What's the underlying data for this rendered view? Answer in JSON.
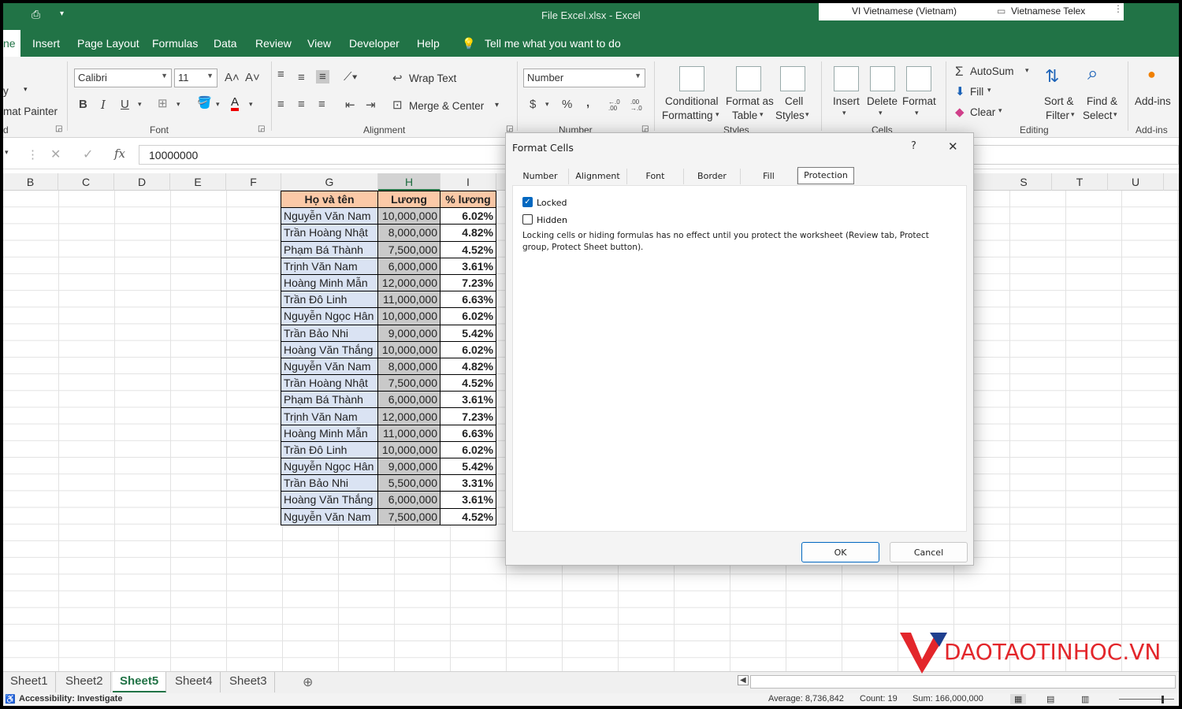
{
  "window": {
    "title": "File Excel.xlsx  -  Excel"
  },
  "language_bar": {
    "ime": "VI  Vietnamese (Vietnam)",
    "keyboard": "Vietnamese Telex"
  },
  "menu": {
    "items": [
      "ne",
      "Insert",
      "Page Layout",
      "Formulas",
      "Data",
      "Review",
      "View",
      "Developer",
      "Help"
    ],
    "tell_me": "Tell me what you want to do"
  },
  "ribbon": {
    "clipboard": {
      "copy": "y",
      "format_painter": "mat Painter",
      "group": "d"
    },
    "font": {
      "name": "Calibri",
      "size": "11",
      "group": "Font",
      "bold": "B",
      "italic": "I",
      "underline": "U",
      "font_color": "A"
    },
    "alignment": {
      "wrap_text": "Wrap Text",
      "merge_center": "Merge & Center",
      "group": "Alignment"
    },
    "number": {
      "format": "Number",
      "group": "Number",
      "currency": "$",
      "percent": "%",
      "comma": ",",
      "inc_decimal": "←.0 .00",
      "dec_decimal": ".00 →.0"
    },
    "styles": {
      "conditional_1": "Conditional",
      "conditional_2": "Formatting",
      "format_table_1": "Format as",
      "format_table_2": "Table",
      "cell_styles_1": "Cell",
      "cell_styles_2": "Styles",
      "group": "Styles"
    },
    "cells": {
      "insert": "Insert",
      "delete": "Delete",
      "format": "Format",
      "group": "Cells"
    },
    "editing": {
      "autosum": "AutoSum",
      "fill": "Fill",
      "clear": "Clear",
      "sort_1": "Sort &",
      "sort_2": "Filter",
      "find_1": "Find &",
      "find_2": "Select",
      "group": "Editing"
    },
    "addins": {
      "label": "Add-ins",
      "group": "Add-ins"
    }
  },
  "formula_bar": {
    "value": "10000000",
    "fx": "fx"
  },
  "columns": [
    {
      "label": "B",
      "w": 70
    },
    {
      "label": "C",
      "w": 71
    },
    {
      "label": "D",
      "w": 71
    },
    {
      "label": "E",
      "w": 71
    },
    {
      "label": "F",
      "w": 70
    },
    {
      "label": "G",
      "w": 123
    },
    {
      "label": "H",
      "w": 79
    },
    {
      "label": "I",
      "w": 71
    }
  ],
  "right_columns": [
    "S",
    "T",
    "U"
  ],
  "table": {
    "headers": [
      "Họ và tên",
      "Lương",
      "% lương"
    ],
    "rows": [
      [
        "Nguyễn Văn Nam",
        "10,000,000",
        "6.02%"
      ],
      [
        "Trần Hoàng Nhật",
        "8,000,000",
        "4.82%"
      ],
      [
        "Phạm Bá Thành",
        "7,500,000",
        "4.52%"
      ],
      [
        "Trịnh Văn Nam",
        "6,000,000",
        "3.61%"
      ],
      [
        "Hoàng Minh Mẫn",
        "12,000,000",
        "7.23%"
      ],
      [
        "Trần Đô Linh",
        "11,000,000",
        "6.63%"
      ],
      [
        "Nguyễn Ngọc Hân",
        "10,000,000",
        "6.02%"
      ],
      [
        "Trần Bảo Nhi",
        "9,000,000",
        "5.42%"
      ],
      [
        "Hoàng Văn Thắng",
        "10,000,000",
        "6.02%"
      ],
      [
        "Nguyễn Văn Nam",
        "8,000,000",
        "4.82%"
      ],
      [
        "Trần Hoàng Nhật",
        "7,500,000",
        "4.52%"
      ],
      [
        "Phạm Bá Thành",
        "6,000,000",
        "3.61%"
      ],
      [
        "Trịnh Văn Nam",
        "12,000,000",
        "7.23%"
      ],
      [
        "Hoàng Minh Mẫn",
        "11,000,000",
        "6.63%"
      ],
      [
        "Trần Đô Linh",
        "10,000,000",
        "6.02%"
      ],
      [
        "Nguyễn Ngọc Hân",
        "9,000,000",
        "5.42%"
      ],
      [
        "Trần Bảo Nhi",
        "5,500,000",
        "3.31%"
      ],
      [
        "Hoàng Văn Thắng",
        "6,000,000",
        "3.61%"
      ],
      [
        "Nguyễn Văn Nam",
        "7,500,000",
        "4.52%"
      ]
    ]
  },
  "sheets": [
    "Sheet1",
    "Sheet2",
    "Sheet5",
    "Sheet4",
    "Sheet3"
  ],
  "active_sheet": "Sheet5",
  "status": {
    "accessibility": "Accessibility: Investigate",
    "average": "Average: 8,736,842",
    "count": "Count: 19",
    "sum": "Sum: 166,000,000"
  },
  "dialog": {
    "title": "Format Cells",
    "help": "?",
    "close": "✕",
    "tabs": [
      "Number",
      "Alignment",
      "Font",
      "Border",
      "Fill",
      "Protection"
    ],
    "active_tab": "Protection",
    "locked_label": "Locked",
    "locked_checked": true,
    "hidden_label": "Hidden",
    "hidden_checked": false,
    "note": "Locking cells or hiding formulas has no effect until you protect the worksheet (Review tab, Protect group, Protect Sheet button).",
    "ok": "OK",
    "cancel": "Cancel"
  },
  "watermark": {
    "text": "DAOTAOTINHOC.VN"
  },
  "colors": {
    "excel_green": "#217346",
    "name_fill": "#dae3f3",
    "header_fill": "#fbc9a7",
    "salary_fill": "#c9c9c9",
    "ok_border": "#0067c0",
    "brand_red": "#e3262b"
  }
}
